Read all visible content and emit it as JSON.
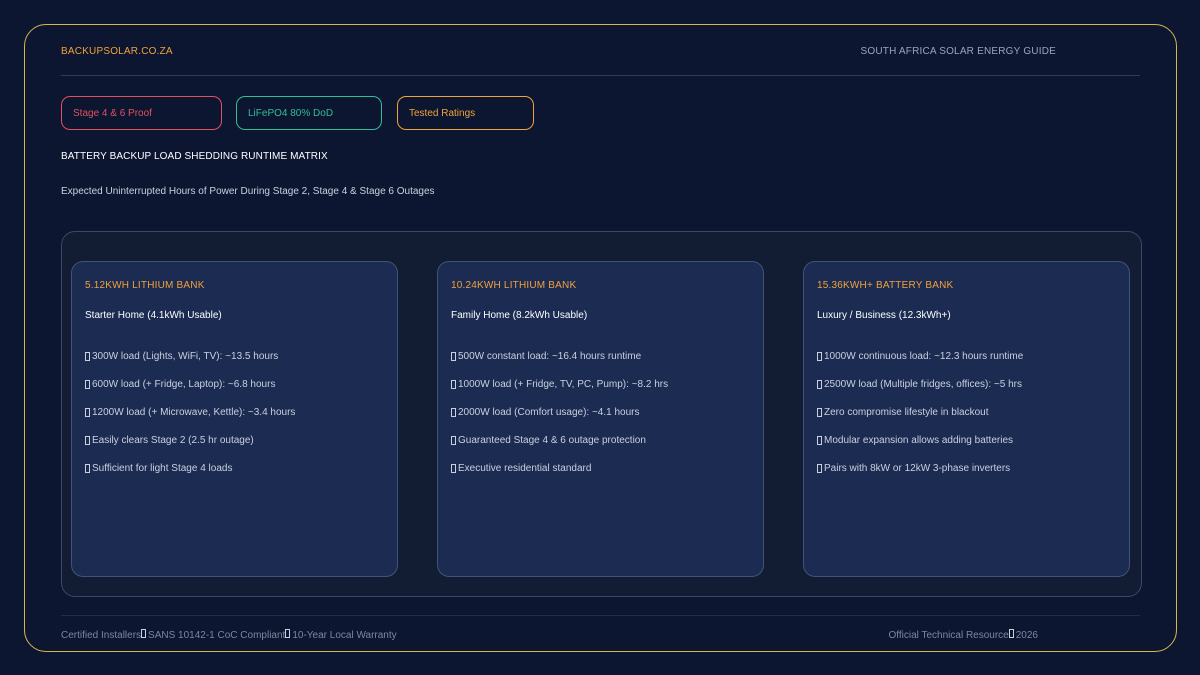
{
  "header": {
    "brand": "BACKUPSOLAR.CO.ZA",
    "guide": "SOUTH AFRICA SOLAR ENERGY GUIDE"
  },
  "badges": [
    {
      "label": "Stage 4 & 6 Proof",
      "color": "#e3505e"
    },
    {
      "label": "LiFePO4 80% DoD",
      "color": "#2fbf98"
    },
    {
      "label": "Tested Ratings",
      "color": "#f2a23a"
    }
  ],
  "title": "BATTERY BACKUP LOAD SHEDDING RUNTIME MATRIX",
  "subtitle": "Expected Uninterrupted Hours of Power During Stage 2, Stage 4 & Stage 6 Outages",
  "cards": [
    {
      "heading": "5.12KWH LITHIUM BANK",
      "sub": "Starter Home (4.1kWh Usable)",
      "items": [
        "300W load (Lights, WiFi, TV): ~13.5 hours",
        "600W load (+ Fridge, Laptop): ~6.8 hours",
        "1200W load (+ Microwave, Kettle): ~3.4 hours",
        "Easily clears Stage 2 (2.5 hr outage)",
        "Sufficient for light Stage 4 loads"
      ]
    },
    {
      "heading": "10.24KWH LITHIUM BANK",
      "sub": "Family Home (8.2kWh Usable)",
      "items": [
        "500W constant load: ~16.4 hours runtime",
        "1000W load (+ Fridge, TV, PC, Pump): ~8.2 hrs",
        "2000W load (Comfort usage): ~4.1 hours",
        "Guaranteed Stage 4 & 6 outage protection",
        "Executive residential standard"
      ]
    },
    {
      "heading": "15.36KWH+ BATTERY BANK",
      "sub": "Luxury / Business (12.3kWh+)",
      "items": [
        "1000W continuous load: ~12.3 hours runtime",
        "2500W load (Multiple fridges, offices): ~5 hrs",
        "Zero compromise lifestyle in blackout",
        "Modular expansion allows adding batteries",
        "Pairs with 8kW or 12kW 3-phase inverters"
      ]
    }
  ],
  "footer": {
    "left": [
      "Certified Installers",
      "SANS 10142-1 CoC Compliant",
      "10-Year Local Warranty"
    ],
    "right": [
      "Official Technical Resource",
      "2026"
    ]
  }
}
